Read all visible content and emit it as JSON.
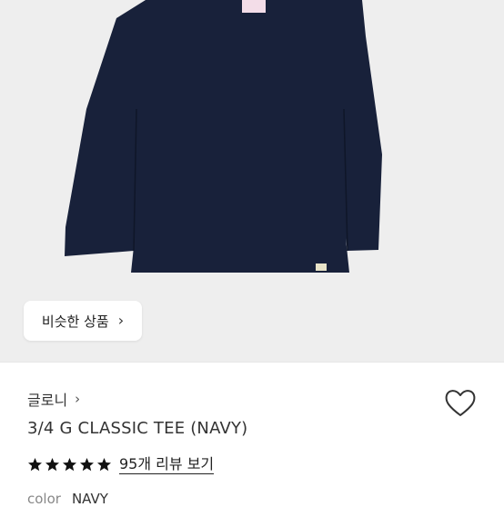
{
  "similar_button": {
    "label": "비슷한 상품",
    "chevron": "›"
  },
  "brand": {
    "name": "글로니",
    "chevron": "›"
  },
  "product": {
    "title": "3/4 G CLASSIC TEE (NAVY)"
  },
  "rating": {
    "stars": 5,
    "review_link": "95개 리뷰 보기"
  },
  "color_option": {
    "label": "color",
    "value": "NAVY"
  },
  "colors": {
    "shirt": "#18213a",
    "image_bg": "#eeeeee",
    "stars": "#111111",
    "heart_stroke": "#333333"
  },
  "icons": [
    "chevron-right-icon",
    "heart-icon",
    "star-icon"
  ]
}
